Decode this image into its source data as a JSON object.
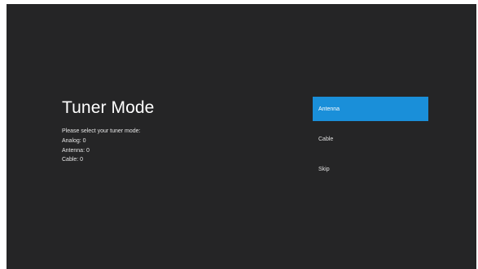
{
  "page": {
    "title": "Tuner Mode",
    "prompt": "Please select your tuner mode:",
    "counts": [
      "Analog: 0",
      "Antenna: 0",
      "Cable: 0"
    ]
  },
  "options": [
    {
      "label": "Antenna",
      "selected": true
    },
    {
      "label": "Cable",
      "selected": false
    },
    {
      "label": "Skip",
      "selected": false
    }
  ],
  "colors": {
    "background": "#252526",
    "highlight": "#1a8fd9",
    "text": "#ffffff"
  }
}
